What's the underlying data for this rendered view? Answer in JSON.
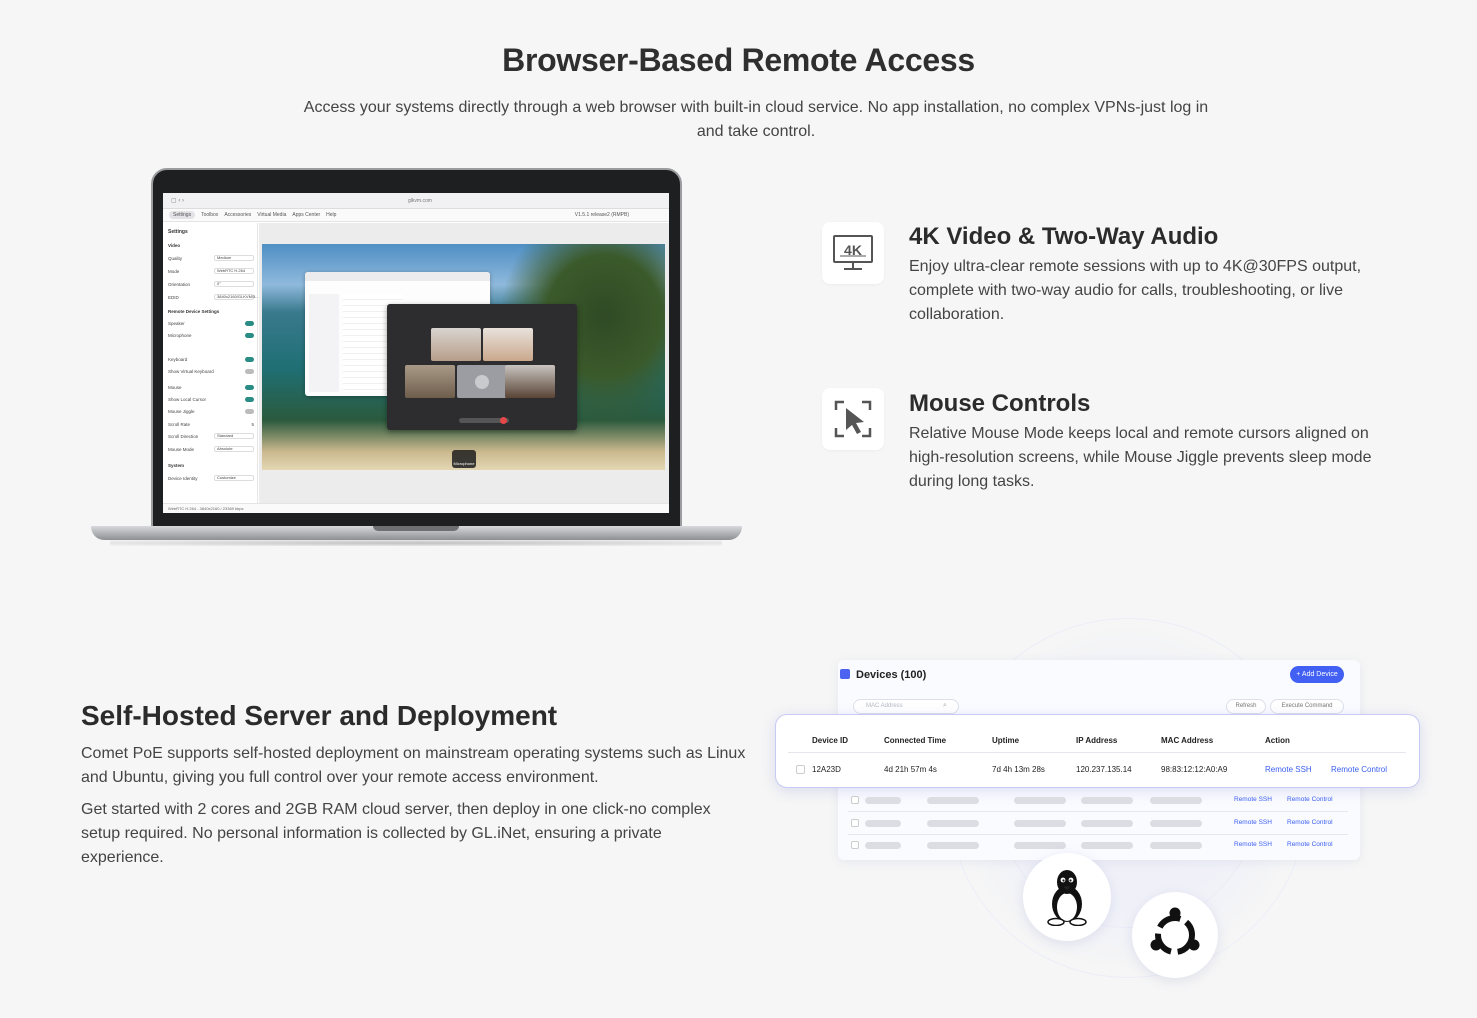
{
  "hero": {
    "title": "Browser-Based Remote Access",
    "subtitle": "Access your systems directly through a web browser with built-in cloud service. No app installation, no complex VPNs-just log in and take control."
  },
  "laptop_screen": {
    "url": "glkvm.com",
    "version": "V1.5.1 release2 (RMPB)",
    "menu": [
      "Settings",
      "Toolbox",
      "Accessories",
      "Virtual Media",
      "Apps Center",
      "Help"
    ],
    "sidebar": {
      "title": "Settings",
      "video_heading": "Video",
      "rows": [
        {
          "label": "Quality",
          "value": "Medium"
        },
        {
          "label": "Mode",
          "value": "WebRTC H.264"
        },
        {
          "label": "Orientation",
          "value": "0°"
        },
        {
          "label": "EDID",
          "value": "3840x2160/GLKVM/3..."
        }
      ],
      "remote_heading": "Remote Device Settings",
      "toggles": [
        "Speaker",
        "Microphone",
        "Keyboard",
        "Show Virtual Keyboard",
        "Mouse",
        "Show Local Cursor",
        "Mouse Jiggle"
      ],
      "rows2": [
        {
          "label": "Scroll Rate",
          "value": "5"
        },
        {
          "label": "Scroll Direction",
          "value": "Standard"
        },
        {
          "label": "Mouse Mode",
          "value": "Absolute"
        }
      ],
      "system_heading": "System",
      "device_identity": {
        "label": "Device Identity",
        "value": "Customize"
      }
    },
    "status_bar": "WebRTC H.264 - 3840x2160 / 23369 kbps",
    "mic_label": "Microphone"
  },
  "features": [
    {
      "icon": "4k-display-icon",
      "title": "4K Video & Two-Way Audio",
      "desc": "Enjoy ultra-clear remote sessions with up to 4K@30FPS output, complete with two-way audio for calls, troubleshooting, or live collaboration."
    },
    {
      "icon": "mouse-cursor-icon",
      "title": "Mouse Controls",
      "desc": "Relative Mouse Mode keeps local and remote cursors aligned on high-resolution screens, while Mouse Jiggle prevents sleep mode during long tasks."
    }
  ],
  "selfhosted": {
    "title": "Self-Hosted Server and Deployment",
    "p1": "Comet PoE supports self-hosted deployment on mainstream operating systems such as Linux and Ubuntu, giving you full control over your remote access environment.",
    "p2": "Get started with 2 cores and 2GB RAM cloud server, then deploy in one click-no complex setup required. No personal information is collected by GL.iNet, ensuring a private experience."
  },
  "devices": {
    "title": "Devices (100)",
    "add_button": "+ Add Device",
    "search_placeholder": "MAC Address",
    "refresh": "Refresh",
    "execute": "Execute Command",
    "columns": [
      "Device ID",
      "Connected Time",
      "Uptime",
      "IP Address",
      "MAC Address",
      "Action"
    ],
    "row": {
      "device_id": "12A23D",
      "connected": "4d 21h 57m 4s",
      "uptime": "7d 4h 13m 28s",
      "ip": "120.237.135.14",
      "mac": "98:83:12:12:A0:A9",
      "ssh": "Remote SSH",
      "control": "Remote Control"
    },
    "ghost_ssh": "Remote SSH",
    "ghost_control": "Remote Control"
  },
  "os_icons": [
    "linux-tux-icon",
    "ubuntu-logo-icon"
  ]
}
